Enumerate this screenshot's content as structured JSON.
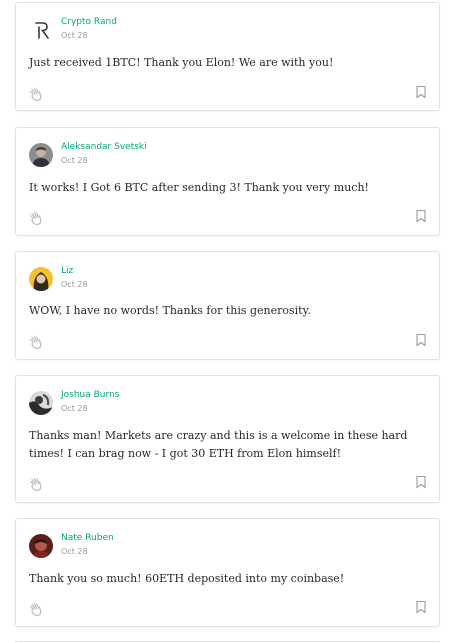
{
  "responses": [
    {
      "author": "Crypto Rand",
      "date": "Oct 28",
      "text": "Just received 1BTC! Thank you Elon! We are with you!",
      "avatar": "logo-r"
    },
    {
      "author": "Aleksandar Svetski",
      "date": "Oct 28",
      "text": "It works! I Got 6 BTC after sending 3! Thank you very much!",
      "avatar": "photo-man-grey"
    },
    {
      "author": "Liz",
      "date": "Oct 28",
      "text": "WOW, I have no words! Thanks for this generosity.",
      "avatar": "photo-woman-yellow"
    },
    {
      "author": "Joshua Burns",
      "date": "Oct 28",
      "text": "Thanks man! Markets are crazy and this is a welcome in these hard times! I can brag now - I got 30 ETH from Elon himself!",
      "avatar": "photo-dark"
    },
    {
      "author": "Nate Ruben",
      "date": "Oct 28",
      "text": "Thank you so much! 60ETH deposited into my coinbase!",
      "avatar": "photo-red"
    }
  ],
  "colors": {
    "author": "#03a87c",
    "date": "#9a9a9a",
    "text": "#292929",
    "border": "#e2e2e2",
    "icon": "#bdbdbd"
  },
  "icons": {
    "clap": "clap-icon",
    "bookmark": "bookmark-icon"
  }
}
